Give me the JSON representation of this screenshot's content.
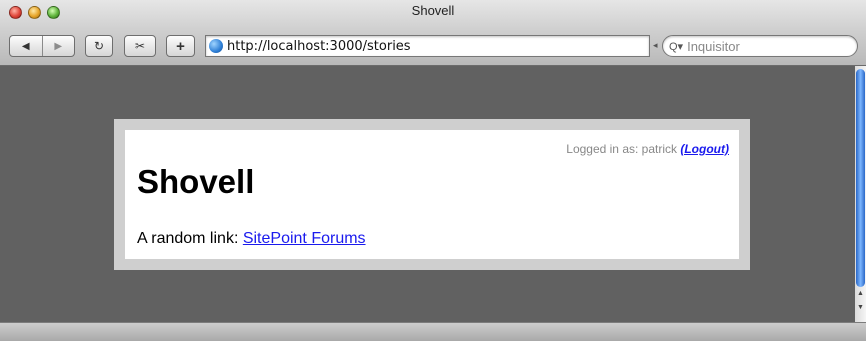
{
  "window": {
    "title": "Shovell"
  },
  "toolbar": {
    "back_icon": "back-arrow-icon",
    "forward_icon": "forward-arrow-icon",
    "reload_glyph": "↻",
    "snapback_glyph": "✂",
    "add_bookmark_glyph": "+",
    "url": "http://localhost:3000/stories",
    "search_placeholder": "Inquisitor"
  },
  "page": {
    "logged_in_prefix": "Logged in as: patrick",
    "logout_label": "(Logout)",
    "heading": "Shovell",
    "random_prefix": "A random link: ",
    "random_link": "SitePoint Forums"
  },
  "colors": {
    "content_bg": "#616161",
    "link": "#1a1aee"
  }
}
